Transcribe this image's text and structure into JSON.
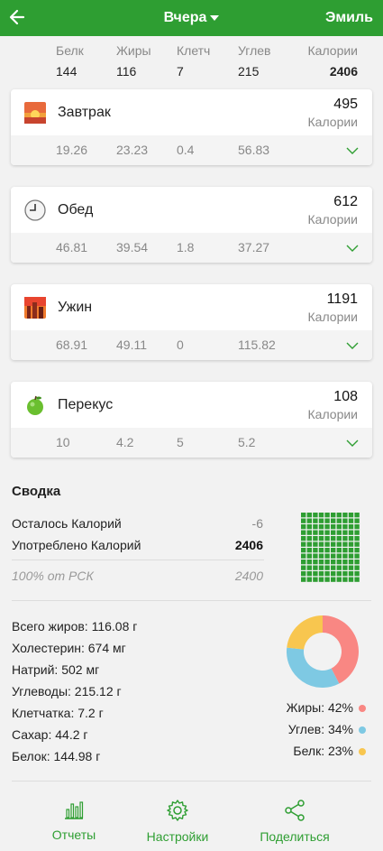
{
  "header": {
    "back_icon": "arrow-left-icon",
    "title": "Вчера",
    "user": "Эмиль"
  },
  "totals": {
    "protein": {
      "label": "Белк",
      "value": "144"
    },
    "fat": {
      "label": "Жиры",
      "value": "116"
    },
    "fiber": {
      "label": "Клетч",
      "value": "7"
    },
    "carbs": {
      "label": "Углев",
      "value": "215"
    },
    "calories": {
      "label": "Калории",
      "value": "2406"
    }
  },
  "meals": [
    {
      "name": "Завтрак",
      "calories": "495",
      "unit": "Калории",
      "protein": "19.26",
      "fat": "23.23",
      "fiber": "0.4",
      "carbs": "56.83",
      "icon": "sunrise-icon"
    },
    {
      "name": "Обед",
      "calories": "612",
      "unit": "Калории",
      "protein": "46.81",
      "fat": "39.54",
      "fiber": "1.8",
      "carbs": "37.27",
      "icon": "clock-icon"
    },
    {
      "name": "Ужин",
      "calories": "1191",
      "unit": "Калории",
      "protein": "68.91",
      "fat": "49.11",
      "fiber": "0",
      "carbs": "115.82",
      "icon": "city-sunset-icon"
    },
    {
      "name": "Перекус",
      "calories": "108",
      "unit": "Калории",
      "protein": "10",
      "fat": "4.2",
      "fiber": "5",
      "carbs": "5.2",
      "icon": "apple-icon"
    }
  ],
  "summary": {
    "title": "Сводка",
    "remaining_label": "Осталось Калорий",
    "remaining_value": "-6",
    "consumed_label": "Употреблено Калорий",
    "consumed_value": "2406",
    "rsk_label": "100% от РСК",
    "rsk_value": "2400",
    "grid_fill_fraction": 1.0
  },
  "nutrients": [
    "Всего жиров: 116.08 г",
    "Холестерин: 674 мг",
    "Натрий: 502 мг",
    "Углеводы: 215.12 г",
    "Клетчатка: 7.2 г",
    "Сахар: 44.2 г",
    "Белок: 144.98 г"
  ],
  "chart_data": {
    "type": "pie",
    "categories": [
      "Жиры",
      "Углев",
      "Белк"
    ],
    "values": [
      42,
      34,
      23
    ],
    "legend": [
      "Жиры: 42%",
      "Углев: 34%",
      "Белк: 23%"
    ],
    "colors": [
      "#f98783",
      "#7ec9e3",
      "#f8c64f"
    ],
    "title": ""
  },
  "bottom_nav": [
    {
      "label": "Отчеты",
      "icon": "bar-chart-icon"
    },
    {
      "label": "Настройки",
      "icon": "gear-icon"
    },
    {
      "label": "Поделиться",
      "icon": "share-icon"
    }
  ]
}
